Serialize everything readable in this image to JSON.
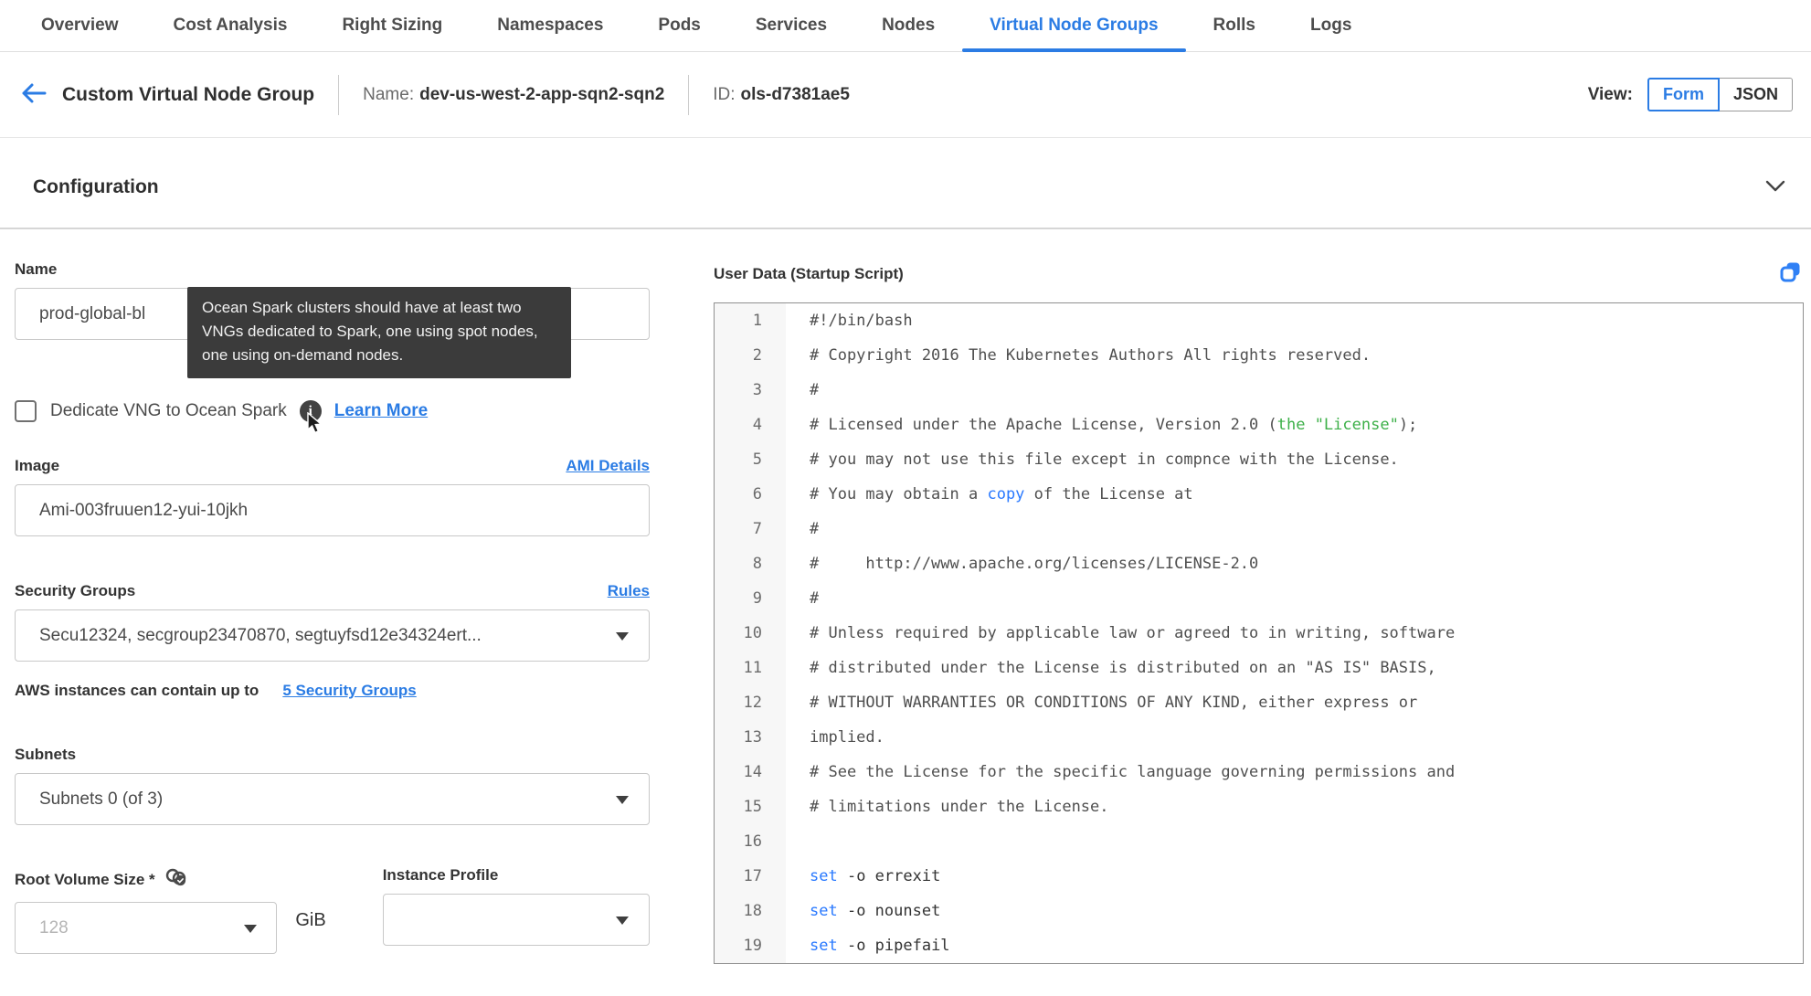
{
  "nav": {
    "tabs": [
      {
        "label": "Overview",
        "active": false
      },
      {
        "label": "Cost Analysis",
        "active": false
      },
      {
        "label": "Right Sizing",
        "active": false
      },
      {
        "label": "Namespaces",
        "active": false
      },
      {
        "label": "Pods",
        "active": false
      },
      {
        "label": "Services",
        "active": false
      },
      {
        "label": "Nodes",
        "active": false
      },
      {
        "label": "Virtual Node Groups",
        "active": true
      },
      {
        "label": "Rolls",
        "active": false
      },
      {
        "label": "Logs",
        "active": false
      }
    ]
  },
  "header": {
    "title": "Custom Virtual Node Group",
    "name_label": "Name:",
    "name_value": "dev-us-west-2-app-sqn2-sqn2",
    "id_label": "ID:",
    "id_value": "ols-d7381ae5",
    "view_label": "View:",
    "view_form": "Form",
    "view_json": "JSON",
    "view_selected": "Form"
  },
  "section": {
    "title": "Configuration"
  },
  "form": {
    "name": {
      "label": "Name",
      "value": "prod-global-bl"
    },
    "tooltip": {
      "text": "Ocean Spark clusters should have at least two VNGs dedicated to Spark, one using spot nodes, one using on-demand nodes."
    },
    "dedicate": {
      "label": "Dedicate VNG to Ocean Spark",
      "checked": false,
      "learn_more": "Learn More"
    },
    "image": {
      "label": "Image",
      "link": "AMI Details",
      "value": "Ami-003fruuen12-yui-10jkh"
    },
    "security_groups": {
      "label": "Security Groups",
      "link": "Rules",
      "value": "Secu12324, secgroup23470870, segtuyfsd12e34324ert...",
      "helper_text": "AWS instances can contain up to",
      "helper_link": "5 Security Groups"
    },
    "subnets": {
      "label": "Subnets",
      "value": "Subnets 0 (of 3)"
    },
    "root_volume": {
      "label": "Root Volume Size *",
      "placeholder": "128",
      "unit": "GiB"
    },
    "instance_profile": {
      "label": "Instance Profile",
      "value": ""
    }
  },
  "user_data": {
    "label": "User Data (Startup Script)",
    "lines": [
      {
        "n": 1,
        "segments": [
          {
            "t": "#!/bin/bash",
            "c": "default"
          }
        ]
      },
      {
        "n": 2,
        "segments": [
          {
            "t": "# Copyright 2016 The Kubernetes Authors All rights reserved.",
            "c": "default"
          }
        ]
      },
      {
        "n": 3,
        "segments": [
          {
            "t": "#",
            "c": "default"
          }
        ]
      },
      {
        "n": 4,
        "segments": [
          {
            "t": "# Licensed under the Apache License, Version 2.0 (",
            "c": "default"
          },
          {
            "t": "the \"License\"",
            "c": "green"
          },
          {
            "t": ");",
            "c": "default"
          }
        ]
      },
      {
        "n": 5,
        "segments": [
          {
            "t": "# you may not use this file except in compnce with the License.",
            "c": "default"
          }
        ]
      },
      {
        "n": 6,
        "segments": [
          {
            "t": "# You may obtain a ",
            "c": "default"
          },
          {
            "t": "copy",
            "c": "blue"
          },
          {
            "t": " of the License at",
            "c": "default"
          }
        ]
      },
      {
        "n": 7,
        "segments": [
          {
            "t": "#",
            "c": "default"
          }
        ]
      },
      {
        "n": 8,
        "segments": [
          {
            "t": "#     http://www.apache.org/licenses/LICENSE-2.0",
            "c": "default"
          }
        ]
      },
      {
        "n": 9,
        "segments": [
          {
            "t": "#",
            "c": "default"
          }
        ]
      },
      {
        "n": 10,
        "segments": [
          {
            "t": "# Unless required by applicable law or agreed to in writing, software",
            "c": "default"
          }
        ]
      },
      {
        "n": 11,
        "segments": [
          {
            "t": "# distributed under the License is distributed on an \"AS IS\" BASIS,",
            "c": "default"
          }
        ]
      },
      {
        "n": 12,
        "segments": [
          {
            "t": "# WITHOUT WARRANTIES OR CONDITIONS OF ANY KIND, either express or",
            "c": "default"
          }
        ]
      },
      {
        "n": 13,
        "segments": [
          {
            "t": "implied.",
            "c": "default"
          }
        ]
      },
      {
        "n": 14,
        "segments": [
          {
            "t": "# See the License for the specific language governing permissions and",
            "c": "default"
          }
        ]
      },
      {
        "n": 15,
        "segments": [
          {
            "t": "# limitations under the License.",
            "c": "default"
          }
        ]
      },
      {
        "n": 16,
        "segments": []
      },
      {
        "n": 17,
        "segments": [
          {
            "t": "set",
            "c": "blue"
          },
          {
            "t": " -o errexit",
            "c": "dark"
          }
        ]
      },
      {
        "n": 18,
        "segments": [
          {
            "t": "set",
            "c": "blue"
          },
          {
            "t": " -o nounset",
            "c": "dark"
          }
        ]
      },
      {
        "n": 19,
        "segments": [
          {
            "t": "set",
            "c": "blue"
          },
          {
            "t": " -o pipefail",
            "c": "dark"
          }
        ]
      }
    ]
  },
  "colors": {
    "accent_blue": "#2b7ce4",
    "code_keyword_blue": "#2979ff",
    "code_string_green": "#3db049",
    "tooltip_bg": "#3b3b3b",
    "active_tab_underline": "#2b7ce4"
  },
  "icons": {
    "back": "back-arrow-icon",
    "chevron": "chevron-down-icon",
    "info": "info-icon",
    "cursor": "mouse-cursor-icon",
    "link_check": "link-check-icon",
    "copy": "copy-icon",
    "caret": "caret-down-icon"
  }
}
